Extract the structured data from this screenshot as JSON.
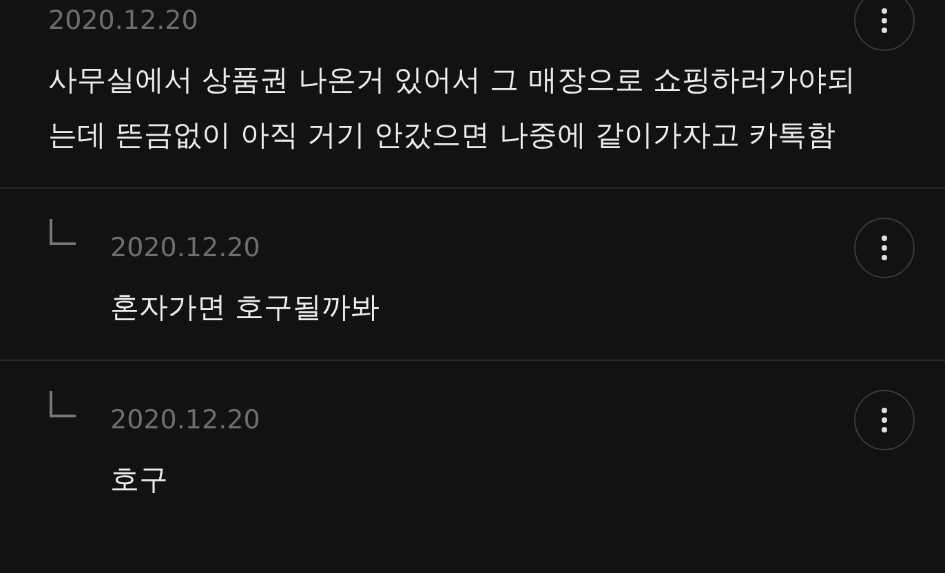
{
  "comments": [
    {
      "kind": "comment",
      "date": "2020.12.20",
      "text": "사무실에서 상품권 나온거 있어서 그 매장으로 쇼핑하러가야되는데 뜬금없이 아직 거기 안갔으면 나중에 같이가자고 카톡함"
    },
    {
      "kind": "reply",
      "date": "2020.12.20",
      "text": "혼자가면 호구될까봐"
    },
    {
      "kind": "reply",
      "date": "2020.12.20",
      "text": "호구"
    }
  ]
}
